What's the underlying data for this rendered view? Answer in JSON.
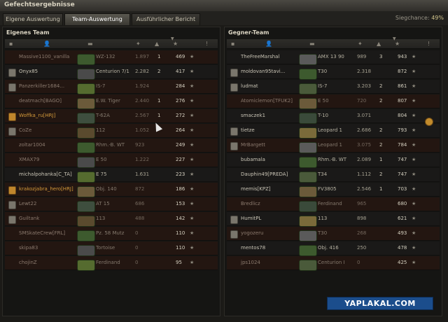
{
  "window": {
    "title": "Gefechtsergebnisse"
  },
  "tabs": [
    {
      "label": "Eigene Auswertung"
    },
    {
      "label": "Team-Auswertung"
    },
    {
      "label": "Ausführlicher Bericht"
    }
  ],
  "siegchance": {
    "label": "Siegchance:",
    "value": "49%"
  },
  "own_team": {
    "title": "Eigenes Team",
    "rows": [
      {
        "player": "Massive1100_vanilla",
        "tank": "WZ-132",
        "damage": "1.897",
        "kills": "1",
        "xp": "469"
      },
      {
        "player": "Onyx85",
        "tank": "Centurion 7/1",
        "damage": "2.282",
        "kills": "2",
        "xp": "417"
      },
      {
        "player": "Panzerkiller1684...",
        "tank": "IS-7",
        "damage": "1.924",
        "kills": "",
        "xp": "284"
      },
      {
        "player": "deatmach[BAGO]",
        "tank": "E.W. Tiger",
        "damage": "2.440",
        "kills": "1",
        "xp": "276"
      },
      {
        "player": "Woffka_ru[HRJ]",
        "tank": "T-62A",
        "damage": "2.567",
        "kills": "1",
        "xp": "272"
      },
      {
        "player": "CoZe",
        "tank": "112",
        "damage": "1.052",
        "kills": "",
        "xp": "264"
      },
      {
        "player": "zoltar1004",
        "tank": "Rhm.-B. WT",
        "damage": "923",
        "kills": "",
        "xp": "249"
      },
      {
        "player": "XMAX79",
        "tank": "E 50",
        "damage": "1.222",
        "kills": "",
        "xp": "227"
      },
      {
        "player": "michalpohanka[C_TA]",
        "tank": "E 75",
        "damage": "1.631",
        "kills": "",
        "xp": "223"
      },
      {
        "player": "krakozjabra_hero[HRJ]",
        "tank": "Obj. 140",
        "damage": "872",
        "kills": "",
        "xp": "186"
      },
      {
        "player": "Lewt22",
        "tank": "AT 15",
        "damage": "686",
        "kills": "",
        "xp": "153"
      },
      {
        "player": "Guiltank",
        "tank": "113",
        "damage": "488",
        "kills": "",
        "xp": "142"
      },
      {
        "player": "SMSkateCrew[FRL]",
        "tank": "Pz. 58 Mutz",
        "damage": "0",
        "kills": "",
        "xp": "110"
      },
      {
        "player": "skipa83",
        "tank": "Tortoise",
        "damage": "0",
        "kills": "",
        "xp": "110"
      },
      {
        "player": "chojinZ",
        "tank": "Ferdinand",
        "damage": "0",
        "kills": "",
        "xp": "95"
      }
    ]
  },
  "enemy_team": {
    "title": "Gegner-Team",
    "rows": [
      {
        "player": "TheFreeMarshal",
        "tank": "AMX 13 90",
        "damage": "989",
        "kills": "3",
        "xp": "943"
      },
      {
        "player": "moldovan95tavi...",
        "tank": "T30",
        "damage": "2.318",
        "kills": "",
        "xp": "872"
      },
      {
        "player": "ludmat",
        "tank": "IS-7",
        "damage": "3.203",
        "kills": "2",
        "xp": "861"
      },
      {
        "player": "Atomiclemon[TFUK2]",
        "tank": "E 50",
        "damage": "720",
        "kills": "2",
        "xp": "807"
      },
      {
        "player": "smaczek1",
        "tank": "T-10",
        "damage": "3.071",
        "kills": "",
        "xp": "804"
      },
      {
        "player": "tietze",
        "tank": "Leopard 1",
        "damage": "2.686",
        "kills": "2",
        "xp": "793"
      },
      {
        "player": "MrBargett",
        "tank": "Leopard 1",
        "damage": "3.075",
        "kills": "2",
        "xp": "784"
      },
      {
        "player": "bubamala",
        "tank": "Rhm.-B. WT",
        "damage": "2.089",
        "kills": "1",
        "xp": "747"
      },
      {
        "player": "Dauphin49[PREDA]",
        "tank": "T34",
        "damage": "1.112",
        "kills": "2",
        "xp": "747"
      },
      {
        "player": "memis[KPZ]",
        "tank": "FV3805",
        "damage": "2.546",
        "kills": "1",
        "xp": "703"
      },
      {
        "player": "Bredlicz",
        "tank": "Ferdinand",
        "damage": "965",
        "kills": "",
        "xp": "680"
      },
      {
        "player": "HumitPL",
        "tank": "113",
        "damage": "898",
        "kills": "",
        "xp": "621"
      },
      {
        "player": "yogozeru",
        "tank": "T30",
        "damage": "268",
        "kills": "",
        "xp": "493"
      },
      {
        "player": "mentos78",
        "tank": "Obj. 416",
        "damage": "250",
        "kills": "",
        "xp": "478"
      },
      {
        "player": "jps1024",
        "tank": "Centurion I",
        "damage": "0",
        "kills": "",
        "xp": "425"
      }
    ]
  },
  "watermark": "YAPLAKAL.COM",
  "icons": {
    "star": "★",
    "sort": "▼",
    "alert": "!"
  }
}
